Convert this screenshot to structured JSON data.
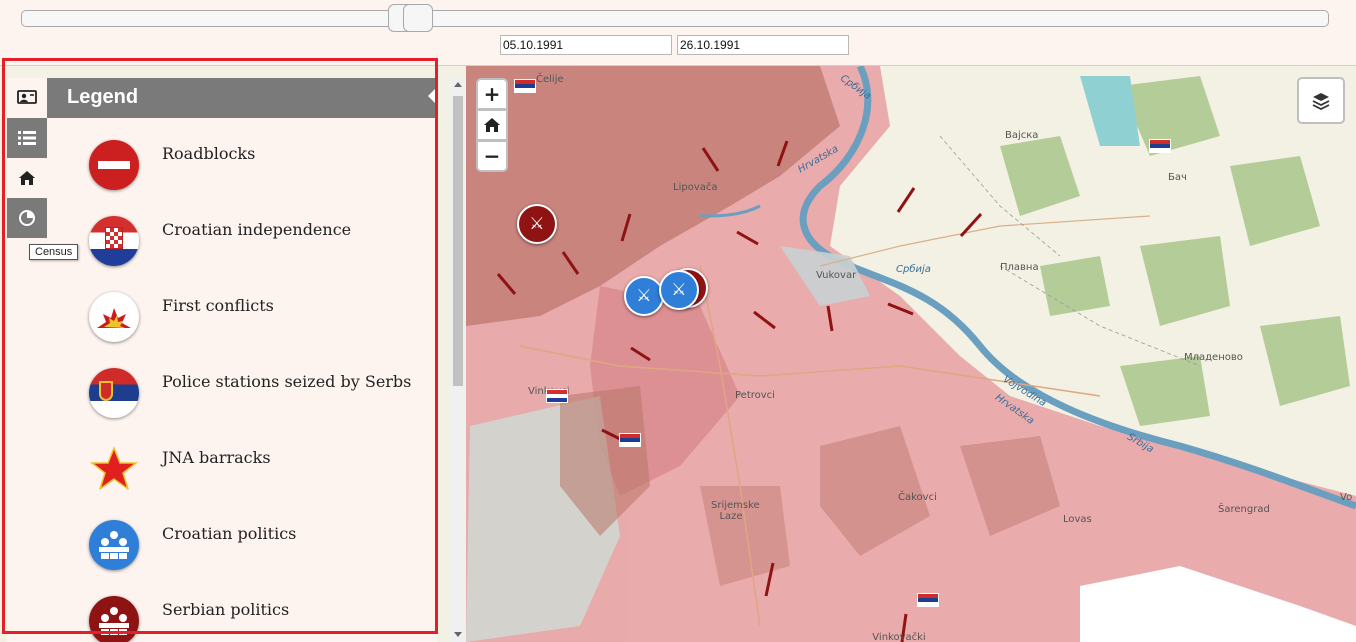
{
  "timeline": {
    "start_date": "05.10.1991",
    "end_date": "26.10.1991"
  },
  "map": {
    "controls": {
      "zoom_in": "+",
      "zoom_out": "−"
    },
    "place_labels": [
      "Čelije",
      "Lipovača",
      "Hrvatska",
      "Vukovar",
      "Vinkovci",
      "Petrovci",
      "Srijemske Laze",
      "Čakovci",
      "Lovas",
      "Šarengrad",
      "Vinkovački Banovci",
      "Вајска",
      "Бач",
      "Плавна",
      "Младеново",
      "Србија",
      "Војводина",
      "Vo"
    ],
    "river_labels": [
      "Србија",
      "Hrvatska",
      "Србија",
      "Vojvodina",
      "Hrvatska",
      "Srbija"
    ]
  },
  "sidebar": {
    "tabs": [
      "legend-tab",
      "list-tab",
      "home-tab",
      "census-tab"
    ],
    "tooltip": "Census",
    "legend": {
      "title": "Legend",
      "items": [
        {
          "label": "Roadblocks",
          "icon": "no-entry-icon"
        },
        {
          "label": "Croatian independence",
          "icon": "croatia-flag-icon"
        },
        {
          "label": "First conflicts",
          "icon": "explosion-icon"
        },
        {
          "label": "Police stations seized by Serbs",
          "icon": "serbia-flag-icon"
        },
        {
          "label": "JNA barracks",
          "icon": "red-star-icon"
        },
        {
          "label": "Croatian politics",
          "icon": "blue-meeting-icon"
        },
        {
          "label": "Serbian politics",
          "icon": "red-meeting-icon"
        }
      ]
    }
  },
  "colors": {
    "occupied": "#d98e8e",
    "river": "#6a9fc0",
    "highlight": "#e3202a",
    "croatian": "#2f7fd8",
    "serbian": "#8f1313"
  }
}
